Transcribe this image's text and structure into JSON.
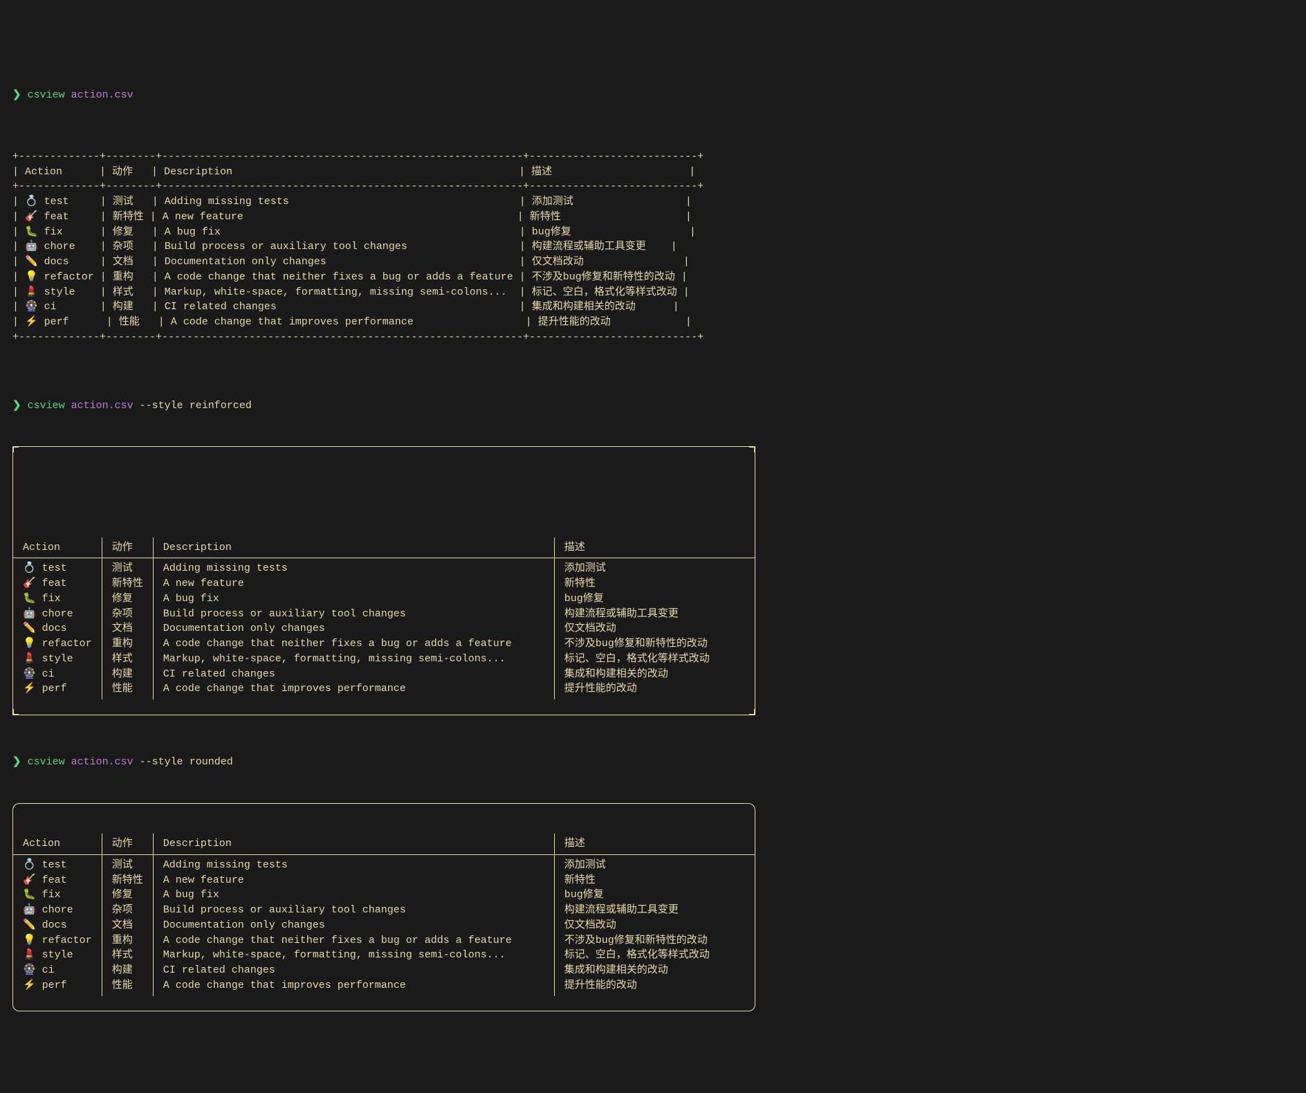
{
  "commands": {
    "c1": {
      "prompt": "❯",
      "cmd": "csview",
      "arg": "action.csv",
      "flag": "",
      "flagval": ""
    },
    "c2": {
      "prompt": "❯",
      "cmd": "csview",
      "arg": "action.csv",
      "flag": "--style",
      "flagval": "reinforced"
    },
    "c3": {
      "prompt": "❯",
      "cmd": "csview",
      "arg": "action.csv",
      "flag": "--style",
      "flagval": "rounded"
    }
  },
  "headers": {
    "action": "Action",
    "dongzuo": "动作",
    "description": "Description",
    "miaoshu": "描述"
  },
  "rows": [
    {
      "icon": "💍",
      "action": "test",
      "zh": "测试",
      "desc": "Adding missing tests",
      "zhdesc": "添加测试"
    },
    {
      "icon": "🎸",
      "action": "feat",
      "zh": "新特性",
      "desc": "A new feature",
      "zhdesc": "新特性"
    },
    {
      "icon": "🐛",
      "action": "fix",
      "zh": "修复",
      "desc": "A bug fix",
      "zhdesc": "bug修复"
    },
    {
      "icon": "🤖",
      "action": "chore",
      "zh": "杂项",
      "desc": "Build process or auxiliary tool changes",
      "zhdesc": "构建流程或辅助工具变更"
    },
    {
      "icon": "✏️",
      "action": "docs",
      "zh": "文档",
      "desc": "Documentation only changes",
      "zhdesc": "仅文档改动"
    },
    {
      "icon": "💡",
      "action": "refactor",
      "zh": "重构",
      "desc": "A code change that neither fixes a bug or adds a feature",
      "zhdesc": "不涉及bug修复和新特性的改动"
    },
    {
      "icon": "💄",
      "action": "style",
      "zh": "样式",
      "desc": "Markup, white-space, formatting, missing semi-colons...",
      "zhdesc": "标记、空白，格式化等样式改动"
    },
    {
      "icon": "🎡",
      "action": "ci",
      "zh": "构建",
      "desc": "CI related changes",
      "zhdesc": "集成和构建相关的改动"
    },
    {
      "icon": "⚡",
      "action": "perf",
      "zh": "性能",
      "desc": "A code change that improves performance",
      "zhdesc": "提升性能的改动"
    }
  ],
  "ascii": {
    "hr": "+-------------+--------+----------------------------------------------------------+---------------------------+",
    "hdr": "| Action      | 动作   | Description                                              | 描述                      |"
  }
}
